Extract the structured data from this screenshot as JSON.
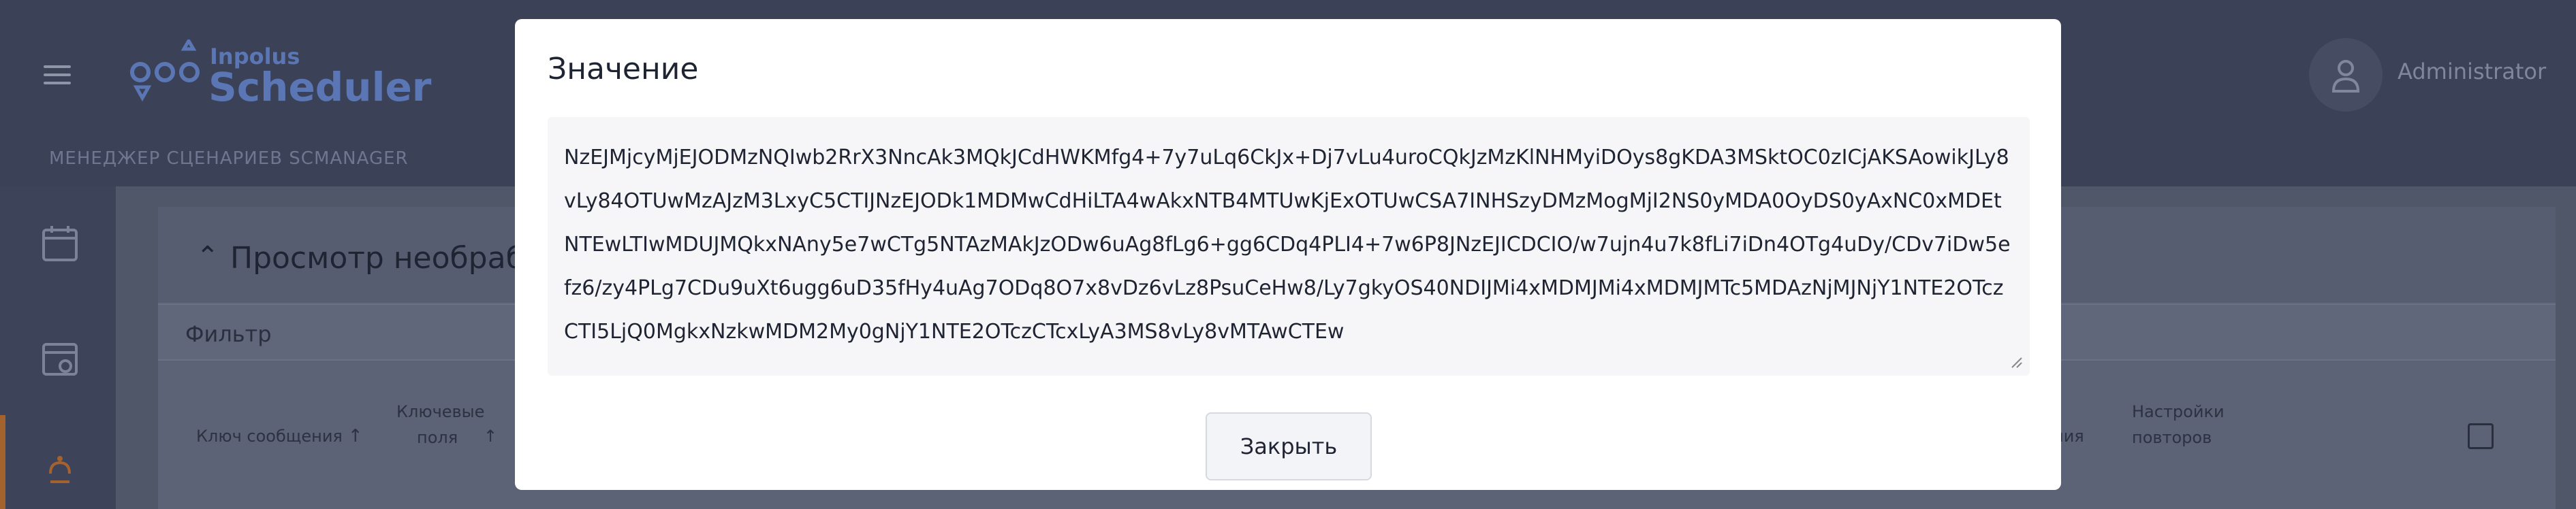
{
  "app": {
    "brand_small": "Inpolus",
    "brand_big": "Scheduler",
    "subtitle": "МЕНЕДЖЕР СЦЕНАРИЕВ SCMANAGER",
    "user_name": "Administrator"
  },
  "sidebar": {
    "items": [
      {
        "icon": "calendar-icon"
      },
      {
        "icon": "inbox-view-icon"
      },
      {
        "icon": "scheduler-icon",
        "active": true
      }
    ],
    "active_color": "#a4622f"
  },
  "panel": {
    "title": "Просмотр необработа",
    "filter_label": "Фильтр",
    "columns": {
      "message_key": "Ключ сообщения",
      "key_fields_line1": "Ключевые",
      "key_fields_line2": "поля",
      "partial_right": "ния",
      "retry_line1": "Настройки",
      "retry_line2": "повторов"
    }
  },
  "modal": {
    "title": "Значение",
    "value_text": "NzEJMjcyMjEJODMzNQIwb2RrX3NncAk3MQkJCdHWKMfg4+7y7uLq6CkJx+Dj7vLu4uroCQkJzMzKlNHMyiDOys8gKDA3MSktOC0zICjAKSAowikJLy8vLy84OTUwMzAJzM3LxyC5CTIJNzEJODk1MDMwCdHiLTA4wAkxNTB4MTUwKjExOTUwCSA7INHSzyDMzMogMjI2NS0yMDA0OyDS0yAxNC0xMDEtNTEwLTIwMDUJMQkxNAny5e7wCTg5NTAzMAkJzODw6uAg8fLg6+gg6CDq4PLI4+7w6P8JNzEJICDCIO/w7ujn4u7k8fLi7iDn4OTg4uDy/CDv7iDw5efz6/zy4PLg7CDu9uXt6ugg6uD35fHy4uAg7ODq8O7x8vDz6vLz8PsuCeHw8/Ly7gkyOS40NDIJMi4xMDMJMi4xMDMJMTc5MDAzNjMJNjY1NTE2OTczCTI5LjQ0MgkxNzkwMDM2My0gNjY1NTE2OTczCTcxLyA3MS8vLy8vMTAwCTEw"
  },
  "buttons": {
    "close_label": "Закрыть"
  }
}
